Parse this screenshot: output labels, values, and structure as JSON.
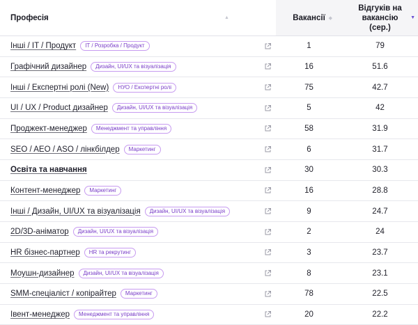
{
  "header": {
    "profession": "Професія",
    "vacancies": "Вакансії",
    "responses_line1": "Відгуків на вакансію",
    "responses_line2": "(сер.)",
    "sort_icon": "sort-arrows-icon",
    "sort_active_icon": "sort-desc-icon"
  },
  "accent_color": "#7a3ec8",
  "rows": [
    {
      "name": "Інші / IT / Продукт",
      "tag": "IT / Розробка / Продукт",
      "vacancies": "1",
      "responses": "79",
      "bold": false
    },
    {
      "name": "Графічний дизайнер",
      "tag": "Дизайн, UI/UX та візуалізація",
      "vacancies": "16",
      "responses": "51.6",
      "bold": false
    },
    {
      "name": "Інші / Експертні ролі (New)",
      "tag": "НУО / Експертні ролі",
      "vacancies": "75",
      "responses": "42.7",
      "bold": false
    },
    {
      "name": "UI / UX / Product дизайнер",
      "tag": "Дизайн, UI/UX та візуалізація",
      "vacancies": "5",
      "responses": "42",
      "bold": false
    },
    {
      "name": "Проджект-менеджер",
      "tag": "Менеджмент та управління",
      "vacancies": "58",
      "responses": "31.9",
      "bold": false
    },
    {
      "name": "SEO / AEO / ASO / лінкбілдер",
      "tag": "Маркетинг",
      "vacancies": "6",
      "responses": "31.7",
      "bold": false
    },
    {
      "name": "Освіта та навчання",
      "tag": "",
      "vacancies": "30",
      "responses": "30.3",
      "bold": true
    },
    {
      "name": "Контент-менеджер",
      "tag": "Маркетинг",
      "vacancies": "16",
      "responses": "28.8",
      "bold": false
    },
    {
      "name": "Інші / Дизайн, UI/UX та візуалізація",
      "tag": "Дизайн, UI/UX та візуалізація",
      "vacancies": "9",
      "responses": "24.7",
      "bold": false
    },
    {
      "name": "2D/3D-аніматор",
      "tag": "Дизайн, UI/UX та візуалізація",
      "vacancies": "2",
      "responses": "24",
      "bold": false
    },
    {
      "name": "HR бізнес-партнер",
      "tag": "HR та рекрутинг",
      "vacancies": "3",
      "responses": "23.7",
      "bold": false
    },
    {
      "name": "Моушн-дизайнер",
      "tag": "Дизайн, UI/UX та візуалізація",
      "vacancies": "8",
      "responses": "23.1",
      "bold": false
    },
    {
      "name": "SMM-спеціаліст / копірайтер",
      "tag": "Маркетинг",
      "vacancies": "78",
      "responses": "22.5",
      "bold": false
    },
    {
      "name": "Івент-менеджер",
      "tag": "Менеджмент та управління",
      "vacancies": "20",
      "responses": "22.2",
      "bold": false
    }
  ]
}
